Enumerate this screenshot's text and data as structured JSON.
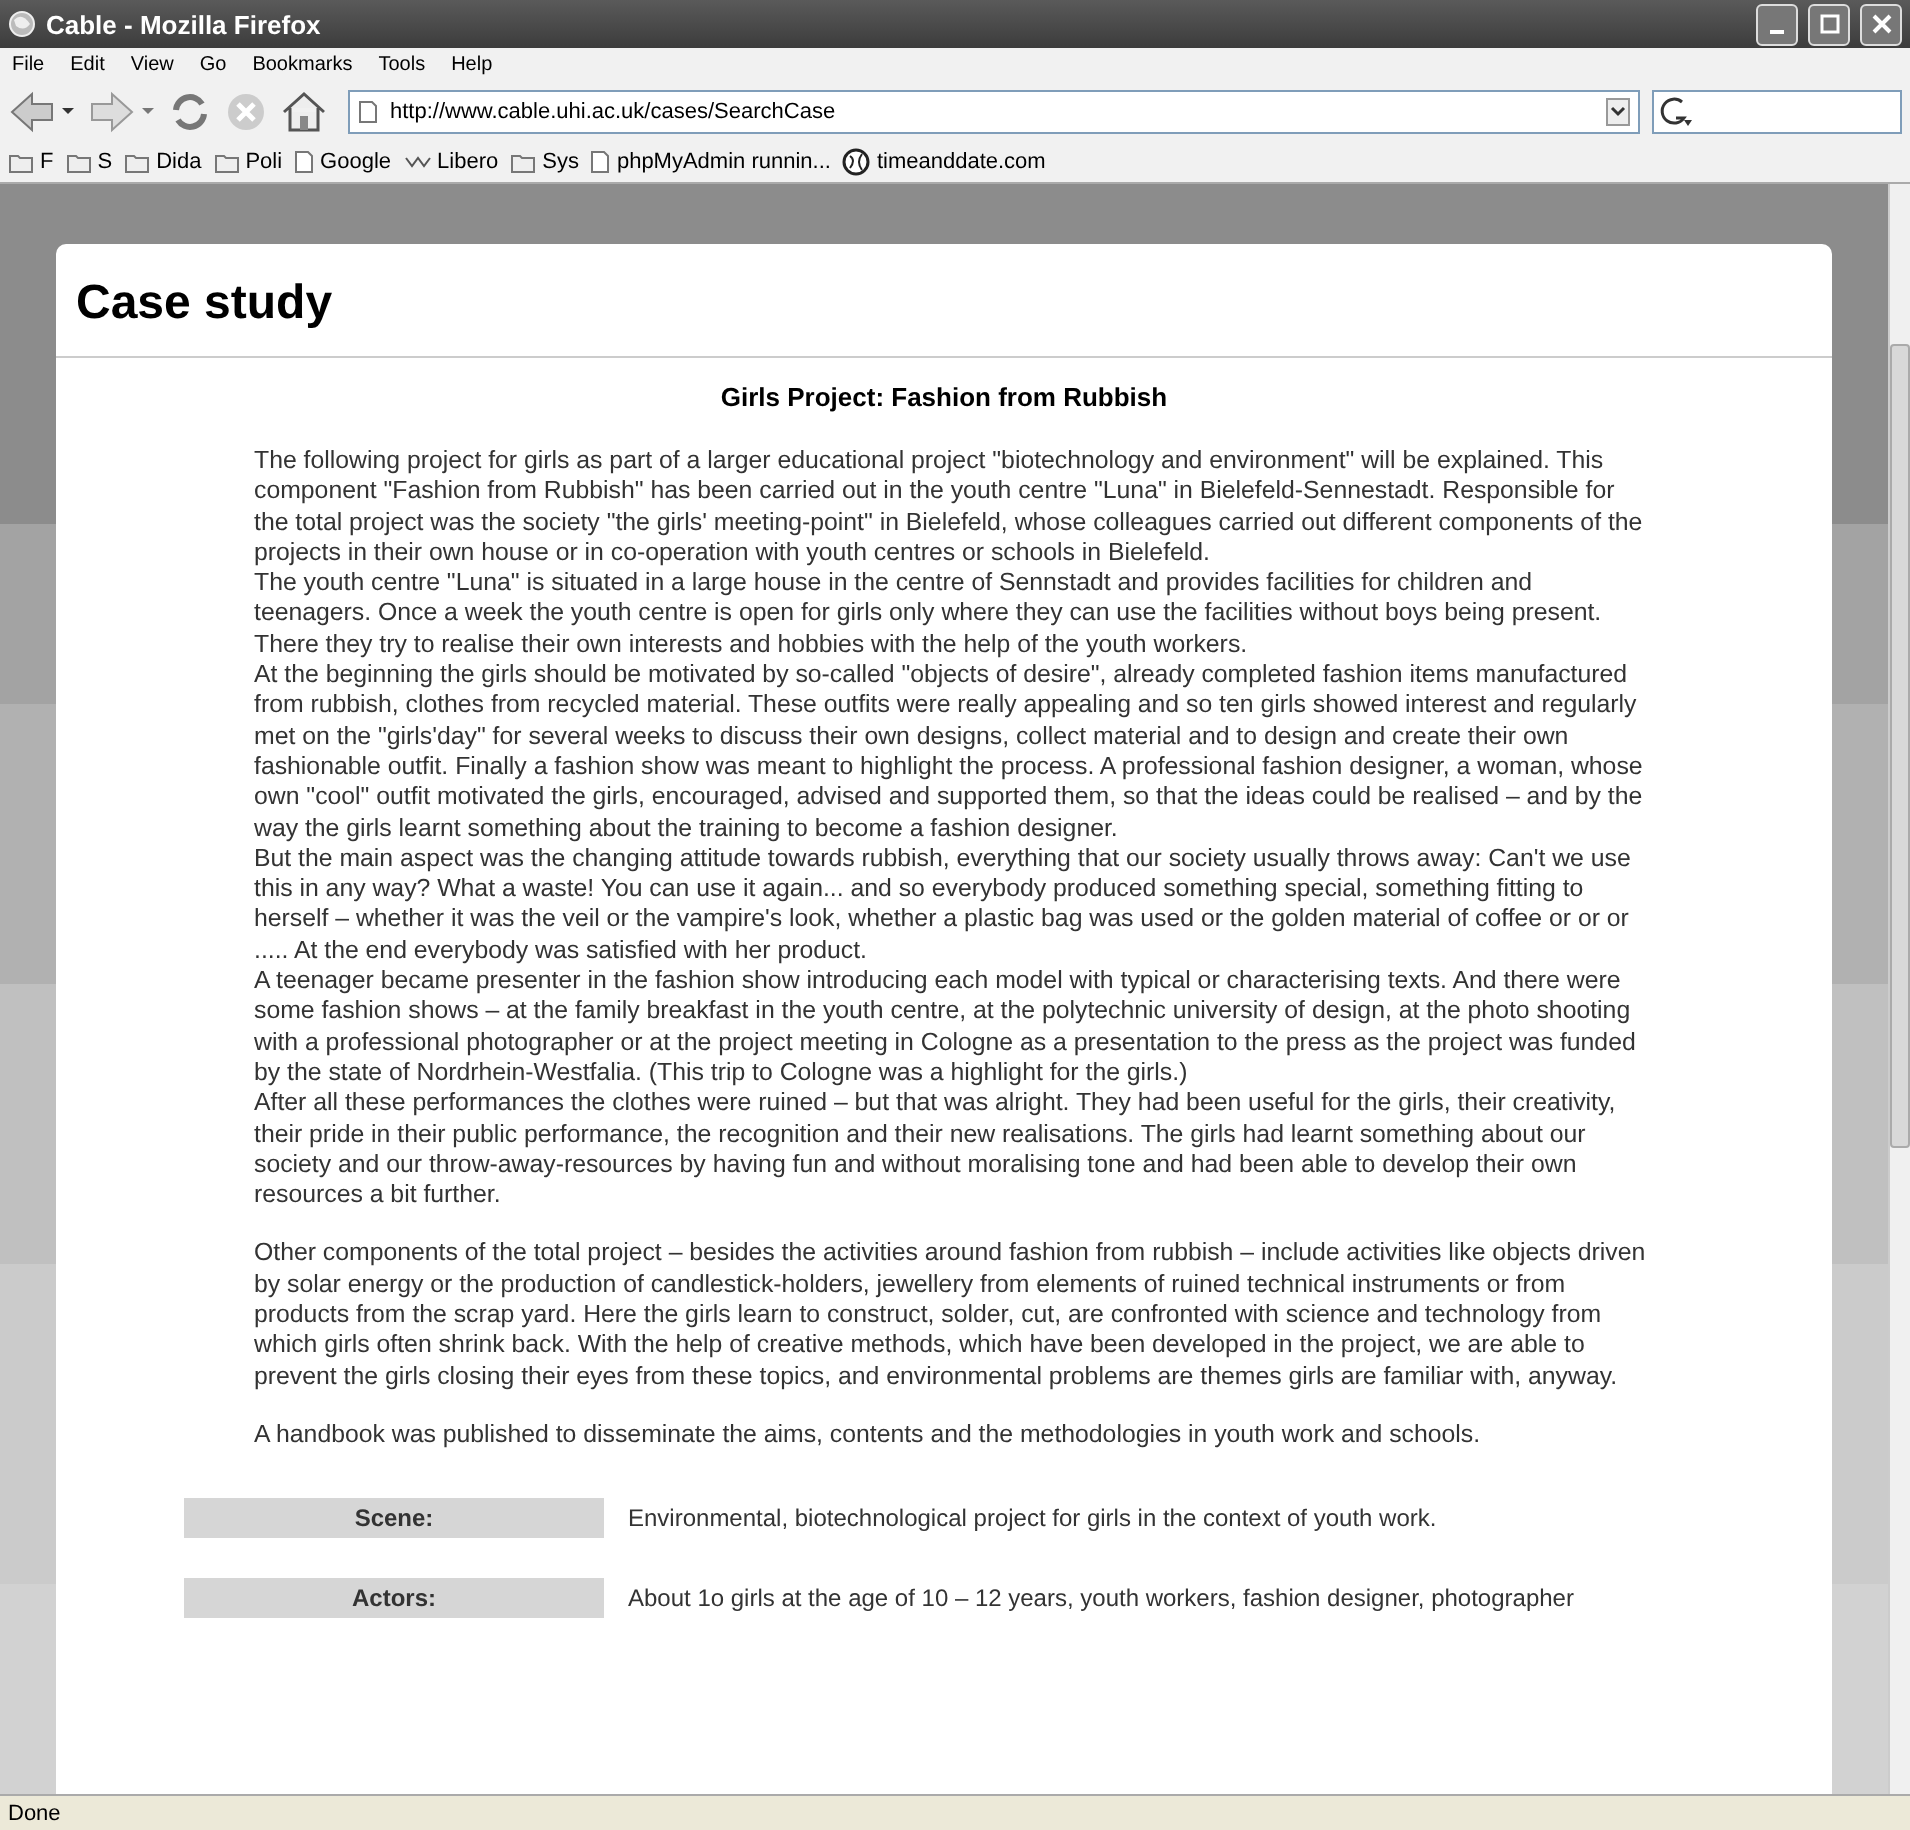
{
  "window": {
    "title": "Cable - Mozilla Firefox"
  },
  "menu": [
    "File",
    "Edit",
    "View",
    "Go",
    "Bookmarks",
    "Tools",
    "Help"
  ],
  "address": {
    "value": "http://www.cable.uhi.ac.uk/cases/SearchCase"
  },
  "bookmarks": [
    {
      "kind": "folder",
      "label": "F"
    },
    {
      "kind": "folder",
      "label": "S"
    },
    {
      "kind": "folder",
      "label": "Dida"
    },
    {
      "kind": "folder",
      "label": "Poli"
    },
    {
      "kind": "page",
      "label": "Google"
    },
    {
      "kind": "wave",
      "label": "Libero"
    },
    {
      "kind": "folder",
      "label": "Sys"
    },
    {
      "kind": "page",
      "label": "phpMyAdmin runnin..."
    },
    {
      "kind": "globe",
      "label": "timeanddate.com"
    }
  ],
  "page": {
    "heading": "Case study",
    "title": "Girls Project: Fashion from Rubbish",
    "sections": [
      [
        "The following project for girls as part of a larger educational project \"biotechnology and environment\" will be explained. This component \"Fashion from Rubbish\" has been carried out in the youth centre \"Luna\" in Bielefeld-Sennestadt. Responsible for the total project was the society \"the girls' meeting-point\" in Bielefeld, whose colleagues carried out different components of the projects in their own house or in co-operation with youth centres or schools in Bielefeld.",
        "The youth centre \"Luna\" is situated in a large house in the centre of Sennstadt and provides facilities for children and teenagers. Once a week the youth centre is open for girls only where they can use the facilities without boys being present. There they try to realise their own interests and hobbies with the help of the youth workers.",
        "At the beginning the girls should be motivated by so-called \"objects of desire\", already completed fashion items manufactured from rubbish, clothes from recycled material. These outfits were really appealing and so ten girls showed interest and regularly met on the \"girls'day\" for several weeks to discuss their own designs, collect material and to design and create their own fashionable outfit. Finally a fashion show was meant to highlight the process. A professional fashion designer, a woman, whose own \"cool\" outfit motivated the girls, encouraged, advised and supported them, so that the ideas could be realised – and by the way the girls learnt something about the training to become a fashion designer.",
        "But the main aspect was the changing attitude towards rubbish, everything that our society usually throws away: Can't we use this in any way? What a waste! You can use it again... and so everybody produced something special, something fitting to herself – whether it was the veil or the vampire's look, whether a plastic bag was used or the golden material of coffee or or or ..... At the end everybody was satisfied with her product.",
        "A teenager became presenter in the fashion show introducing each model with typical or characterising texts. And there were some fashion shows – at the family breakfast in the youth centre, at the polytechnic university of design, at the photo shooting with a professional photographer or at the project meeting in Cologne as a presentation to the press as the project was funded by the state of Nordrhein-Westfalia. (This trip to Cologne was a highlight for the girls.)",
        "After all these performances the clothes were ruined – but that was alright. They had been useful for the girls, their creativity, their pride in their public performance, the recognition and their new realisations. The girls had learnt something about our society and our throw-away-resources by having fun and without moralising tone and had been able to develop their own resources a bit further."
      ],
      [
        "Other components of the total project – besides the activities around fashion from rubbish – include activities like objects driven by solar energy or the production of candlestick-holders, jewellery from elements of ruined technical instruments or from products from the scrap yard. Here the girls learn to construct, solder, cut, are confronted with science and technology from which girls often shrink back. With the help of creative methods, which have been developed in the project, we are able to prevent the girls closing their eyes from these topics, and environmental problems are themes girls are familiar with, anyway."
      ],
      [
        "A handbook was published to disseminate the aims, contents and the methodologies in youth work and schools."
      ]
    ],
    "details": [
      {
        "label": "Scene:",
        "value": "Environmental, biotechnological project for girls in the context of youth work."
      },
      {
        "label": "Actors:",
        "value": "About 1o girls at the age of 10 – 12 years, youth workers, fashion designer, photographer"
      }
    ]
  },
  "status_bar": "Done"
}
